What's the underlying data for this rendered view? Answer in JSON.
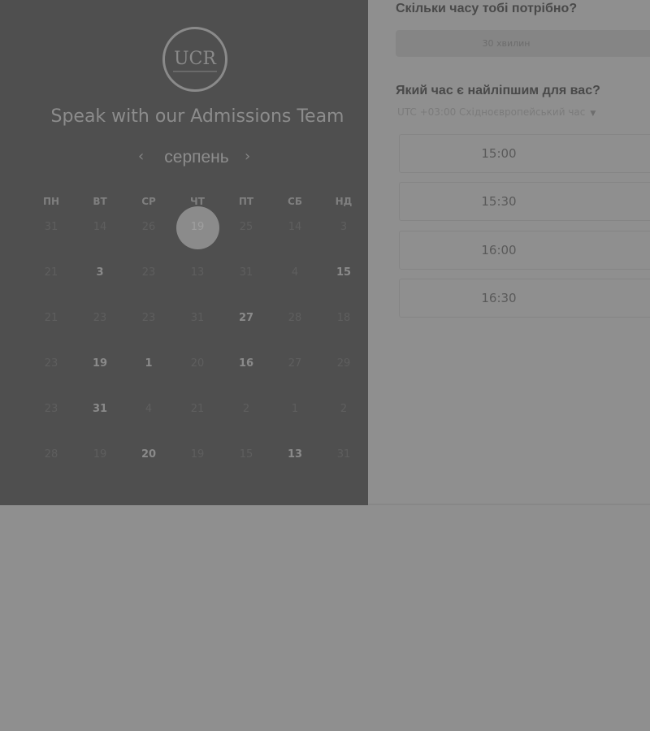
{
  "header": {
    "logo_text": "UCR",
    "title": "Speak with our Admissions Team"
  },
  "calendar": {
    "month": "серпень",
    "prev_icon": "chevron-left-icon",
    "next_icon": "chevron-right-icon",
    "weekdays": [
      "ПН",
      "ВТ",
      "СР",
      "ЧТ",
      "ПТ",
      "СБ",
      "НД"
    ],
    "days": [
      [
        "31",
        "14",
        "26",
        "19",
        "25",
        "14",
        "3"
      ],
      [
        "21",
        "3",
        "23",
        "13",
        "31",
        "4",
        "15"
      ],
      [
        "21",
        "23",
        "23",
        "31",
        "27",
        "28",
        "18"
      ],
      [
        "23",
        "19",
        "1",
        "20",
        "16",
        "27",
        "29"
      ],
      [
        "23",
        "31",
        "4",
        "21",
        "2",
        "1",
        "2"
      ],
      [
        "28",
        "19",
        "20",
        "19",
        "15",
        "13",
        "31"
      ]
    ],
    "available": [
      [
        1,
        1
      ],
      [
        1,
        6
      ],
      [
        2,
        4
      ],
      [
        3,
        1
      ],
      [
        3,
        2
      ],
      [
        3,
        4
      ],
      [
        4,
        1
      ],
      [
        5,
        2
      ],
      [
        5,
        5
      ]
    ],
    "selected": [
      0,
      3
    ]
  },
  "booking": {
    "duration_question": "Скільки часу тобі потрібно?",
    "duration_value": "30 хвилин",
    "time_question": "Який час є найліпшим для вас?",
    "timezone": "UTC +03:00 Східноєвропейський час",
    "timezone_icon": "caret-down-icon",
    "slots": [
      "15:00",
      "15:30",
      "16:00",
      "16:30"
    ]
  },
  "colors": {
    "left_panel": "#4f4f4f",
    "page_background": "#8f8f8f",
    "selected_day": "#8b8b8b"
  }
}
